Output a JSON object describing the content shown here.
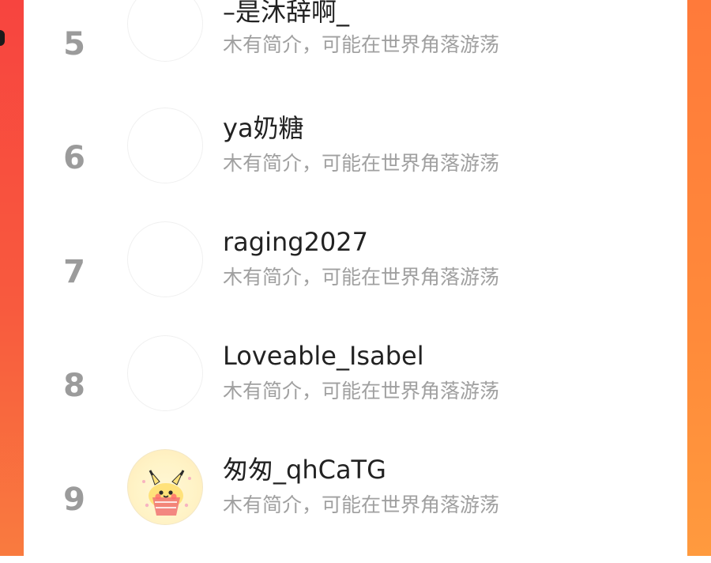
{
  "list": {
    "items": [
      {
        "rank": "5",
        "name": "–是沐辞啊_",
        "desc": "木有简介，可能在世界角落游荡",
        "avatar": "blank-avatar"
      },
      {
        "rank": "6",
        "name": "ya奶糖",
        "desc": "木有简介，可能在世界角落游荡",
        "avatar": "blank-avatar"
      },
      {
        "rank": "7",
        "name": "raging2027",
        "desc": "木有简介，可能在世界角落游荡",
        "avatar": "blank-avatar"
      },
      {
        "rank": "8",
        "name": "Loveable_Isabel",
        "desc": "木有简介，可能在世界角落游荡",
        "avatar": "blank-avatar"
      },
      {
        "rank": "9",
        "name": "匆匆_qhCaTG",
        "desc": "木有简介，可能在世界角落游荡",
        "avatar": "pikachu-avatar"
      }
    ]
  },
  "colors": {
    "rank": "#9b9b9b",
    "name": "#222222",
    "desc": "#a0a0a0",
    "background_accent": "#f76a3b",
    "panel": "#ffffff"
  }
}
